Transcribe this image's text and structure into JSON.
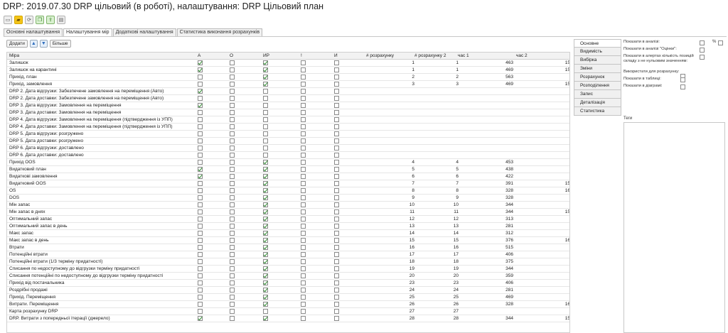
{
  "window_title": "DRP: 2019.07.30 DRP цільовий (в роботі), налаштування: DRP Цільовий план",
  "toolbar_icons": [
    "window-icon",
    "folder-icon",
    "refresh-icon",
    "copy-icon",
    "export-icon",
    "save-icon"
  ],
  "tabs": [
    {
      "label": "Основні налаштування",
      "active": false
    },
    {
      "label": "Налаштування мір",
      "active": true
    },
    {
      "label": "Додаткові налаштування",
      "active": false
    },
    {
      "label": "Статистика виконання розрахунків",
      "active": false
    }
  ],
  "buttons": {
    "add": "Додати",
    "more": "Більше"
  },
  "columns": {
    "name": "Міра",
    "a": "А",
    "o": "О",
    "ir": "ИР",
    "ex": "!",
    "i": "И",
    "n1": "# розрахунку",
    "n2": "# розрахунку 2",
    "h1": "час 1",
    "h2": "час 2"
  },
  "rows": [
    {
      "name": "Залишок",
      "a": true,
      "o": false,
      "ir": true,
      "ex": false,
      "i": false,
      "n1": "1",
      "n2": "1",
      "h1": "463",
      "h2": "15"
    },
    {
      "name": "Залишок на карантині",
      "a": true,
      "o": false,
      "ir": true,
      "ex": false,
      "i": false,
      "n1": "1",
      "n2": "1",
      "h1": "469",
      "h2": "15"
    },
    {
      "name": "Прихід, план",
      "a": false,
      "o": false,
      "ir": true,
      "ex": false,
      "i": false,
      "n1": "2",
      "n2": "2",
      "h1": "563",
      "h2": ""
    },
    {
      "name": "Прихід, замовлення",
      "a": false,
      "o": false,
      "ir": true,
      "ex": false,
      "i": false,
      "n1": "3",
      "n2": "3",
      "h1": "469",
      "h2": "15"
    },
    {
      "name": "DRP 2. Дата відгрузки: Забезпечене замовлення на переміщення (Авто)",
      "a": true,
      "o": false,
      "ir": false,
      "ex": false,
      "i": false,
      "n1": "",
      "n2": "",
      "h1": "",
      "h2": ""
    },
    {
      "name": "DRP 2. Дата доставки: Забезпечене замовлення на переміщення (Авто)",
      "a": false,
      "o": false,
      "ir": false,
      "ex": false,
      "i": false,
      "n1": "",
      "n2": "",
      "h1": "",
      "h2": ""
    },
    {
      "name": "DRP 3. Дата відгрузки: Замовлення на переміщення",
      "a": true,
      "o": false,
      "ir": false,
      "ex": false,
      "i": false,
      "n1": "",
      "n2": "",
      "h1": "",
      "h2": ""
    },
    {
      "name": "DRP 3. Дата доставки: Замовлення на переміщення",
      "a": false,
      "o": false,
      "ir": false,
      "ex": false,
      "i": false,
      "n1": "",
      "n2": "",
      "h1": "",
      "h2": ""
    },
    {
      "name": "DRP 4. Дата відгрузки: Замовлення на переміщення (підтвердження із УПП)",
      "a": false,
      "o": false,
      "ir": false,
      "ex": false,
      "i": false,
      "n1": "",
      "n2": "",
      "h1": "",
      "h2": ""
    },
    {
      "name": "DRP 4. Дата доставки: Замовлення на переміщення (підтвердження із УПП)",
      "a": false,
      "o": false,
      "ir": false,
      "ex": false,
      "i": false,
      "n1": "",
      "n2": "",
      "h1": "",
      "h2": ""
    },
    {
      "name": "DRP 5. Дата відгрузки: розгружено",
      "a": false,
      "o": false,
      "ir": false,
      "ex": false,
      "i": false,
      "n1": "",
      "n2": "",
      "h1": "",
      "h2": ""
    },
    {
      "name": "DRP 5. Дата доставки: розгружено",
      "a": false,
      "o": false,
      "ir": false,
      "ex": false,
      "i": false,
      "n1": "",
      "n2": "",
      "h1": "",
      "h2": ""
    },
    {
      "name": "DRP 6. Дата відгрузки: доставлено",
      "a": false,
      "o": false,
      "ir": false,
      "ex": false,
      "i": false,
      "n1": "",
      "n2": "",
      "h1": "",
      "h2": ""
    },
    {
      "name": "DRP 6. Дата доставки: доставлено",
      "a": false,
      "o": false,
      "ir": false,
      "ex": false,
      "i": false,
      "n1": "",
      "n2": "",
      "h1": "",
      "h2": ""
    },
    {
      "name": "Прихід OOS",
      "a": false,
      "o": false,
      "ir": true,
      "ex": false,
      "i": false,
      "n1": "4",
      "n2": "4",
      "h1": "453",
      "h2": ""
    },
    {
      "name": "Видатковий план",
      "a": true,
      "o": false,
      "ir": true,
      "ex": false,
      "i": false,
      "n1": "5",
      "n2": "5",
      "h1": "438",
      "h2": ""
    },
    {
      "name": "Видаткові замовлення",
      "a": true,
      "o": false,
      "ir": true,
      "ex": false,
      "i": false,
      "n1": "6",
      "n2": "6",
      "h1": "422",
      "h2": ""
    },
    {
      "name": "Видатковий OOS",
      "a": false,
      "o": false,
      "ir": true,
      "ex": false,
      "i": false,
      "n1": "7",
      "n2": "7",
      "h1": "391",
      "h2": "15"
    },
    {
      "name": "OS",
      "a": false,
      "o": false,
      "ir": true,
      "ex": false,
      "i": false,
      "n1": "8",
      "n2": "8",
      "h1": "328",
      "h2": "16"
    },
    {
      "name": "DOS",
      "a": false,
      "o": false,
      "ir": true,
      "ex": false,
      "i": false,
      "n1": "9",
      "n2": "9",
      "h1": "328",
      "h2": ""
    },
    {
      "name": "Мін запас",
      "a": false,
      "o": false,
      "ir": true,
      "ex": false,
      "i": false,
      "n1": "10",
      "n2": "10",
      "h1": "344",
      "h2": ""
    },
    {
      "name": "Мін запас в днях",
      "a": false,
      "o": false,
      "ir": true,
      "ex": false,
      "i": false,
      "n1": "11",
      "n2": "11",
      "h1": "344",
      "h2": "15"
    },
    {
      "name": "Оптимальний запас",
      "a": false,
      "o": false,
      "ir": true,
      "ex": false,
      "i": false,
      "n1": "12",
      "n2": "12",
      "h1": "313",
      "h2": ""
    },
    {
      "name": "Оптимальний запас в день",
      "a": false,
      "o": false,
      "ir": true,
      "ex": false,
      "i": false,
      "n1": "13",
      "n2": "13",
      "h1": "281",
      "h2": ""
    },
    {
      "name": "Макс запас",
      "a": false,
      "o": false,
      "ir": true,
      "ex": false,
      "i": false,
      "n1": "14",
      "n2": "14",
      "h1": "312",
      "h2": ""
    },
    {
      "name": "Макс запас в день",
      "a": false,
      "o": false,
      "ir": true,
      "ex": false,
      "i": false,
      "n1": "15",
      "n2": "15",
      "h1": "376",
      "h2": "16"
    },
    {
      "name": "Втрати",
      "a": false,
      "o": false,
      "ir": true,
      "ex": false,
      "i": false,
      "n1": "16",
      "n2": "16",
      "h1": "515",
      "h2": ""
    },
    {
      "name": "Потенційні втрати",
      "a": false,
      "o": false,
      "ir": true,
      "ex": false,
      "i": false,
      "n1": "17",
      "n2": "17",
      "h1": "406",
      "h2": ""
    },
    {
      "name": "Потенційні втрати (1/3 терміну придатності)",
      "a": false,
      "o": false,
      "ir": true,
      "ex": false,
      "i": false,
      "n1": "18",
      "n2": "18",
      "h1": "375",
      "h2": ""
    },
    {
      "name": "Списання по недоступному до відгрузки терміну придатності",
      "a": false,
      "o": false,
      "ir": true,
      "ex": false,
      "i": false,
      "n1": "19",
      "n2": "19",
      "h1": "344",
      "h2": ""
    },
    {
      "name": "Списання потенційні по недоступному до відгрузки терміну придатності",
      "a": false,
      "o": false,
      "ir": true,
      "ex": false,
      "i": false,
      "n1": "20",
      "n2": "20",
      "h1": "359",
      "h2": ""
    },
    {
      "name": "Прихід від постачальника",
      "a": false,
      "o": false,
      "ir": true,
      "ex": false,
      "i": false,
      "n1": "23",
      "n2": "23",
      "h1": "406",
      "h2": ""
    },
    {
      "name": "Роздрібні продажі",
      "a": false,
      "o": false,
      "ir": true,
      "ex": false,
      "i": false,
      "n1": "24",
      "n2": "24",
      "h1": "281",
      "h2": ""
    },
    {
      "name": "Прихід. Переміщення",
      "a": false,
      "o": false,
      "ir": true,
      "ex": false,
      "i": false,
      "n1": "25",
      "n2": "25",
      "h1": "469",
      "h2": ""
    },
    {
      "name": "Витрати. Переміщення",
      "a": false,
      "o": false,
      "ir": true,
      "ex": false,
      "i": false,
      "n1": "26",
      "n2": "26",
      "h1": "328",
      "h2": "16"
    },
    {
      "name": "Карта розрахунку DRP",
      "a": false,
      "o": false,
      "ir": false,
      "ex": false,
      "i": false,
      "n1": "27",
      "n2": "27",
      "h1": "",
      "h2": ""
    },
    {
      "name": "DRP. Витрати з попередньої ітерації (джерело)",
      "a": true,
      "o": false,
      "ir": true,
      "ex": false,
      "i": false,
      "n1": "28",
      "n2": "28",
      "h1": "344",
      "h2": "15"
    }
  ],
  "side_tabs": [
    "Основне",
    "Видимість",
    "Вибірка",
    "Зміни",
    "Розрахунок",
    "Розподілення",
    "Запис",
    "Деталізація",
    "Статистика"
  ],
  "properties": [
    {
      "label": "Показати в аналізі:",
      "checked": false,
      "extra": "%"
    },
    {
      "label": "Показати в аналізі \"Оцінки\":",
      "checked": false,
      "extra": ""
    },
    {
      "label": "Показати в алертах кількість позицій складу з не нульовим значенням:",
      "checked": false,
      "extra": ""
    },
    {
      "label": "Використати для розрахунку:",
      "checked": false,
      "extra": ""
    },
    {
      "label": "Показати в таблиці:",
      "checked": false,
      "extra": ""
    },
    {
      "label": "Показати в діаграмі:",
      "checked": false,
      "extra": ""
    }
  ],
  "tags_label": "Теги"
}
